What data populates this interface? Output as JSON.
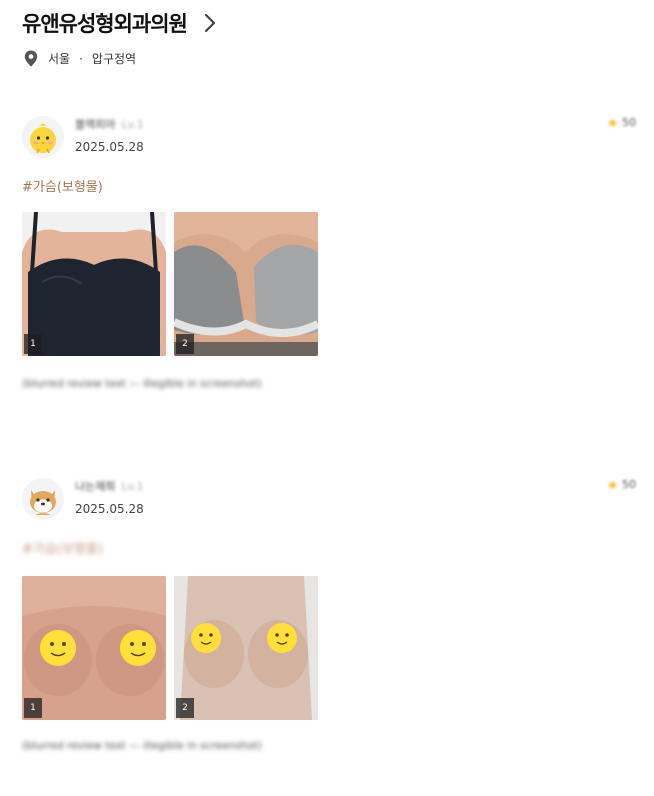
{
  "header": {
    "clinic_name": "유앤유성형외과의원"
  },
  "location": {
    "city": "서울",
    "separator": "·",
    "district": "압구정역"
  },
  "reviews": [
    {
      "nickname": "블랙피아",
      "level": "Lv.1",
      "date": "2025.05.28",
      "points": "50",
      "tag": "#가슴(보형물)",
      "photos": [
        {
          "index": "1"
        },
        {
          "index": "2"
        }
      ],
      "text": "(blurred review text — illegible in screenshot)"
    },
    {
      "nickname": "나는재희",
      "level": "Lv.1",
      "date": "2025.05.28",
      "points": "50",
      "tag": "#가슴(보형물)",
      "photos": [
        {
          "index": "1"
        },
        {
          "index": "2"
        }
      ],
      "text": "(blurred review text — illegible in screenshot)"
    }
  ],
  "colors": {
    "tag": "#a07a57",
    "star": "#f3c844",
    "text": "#111111"
  }
}
